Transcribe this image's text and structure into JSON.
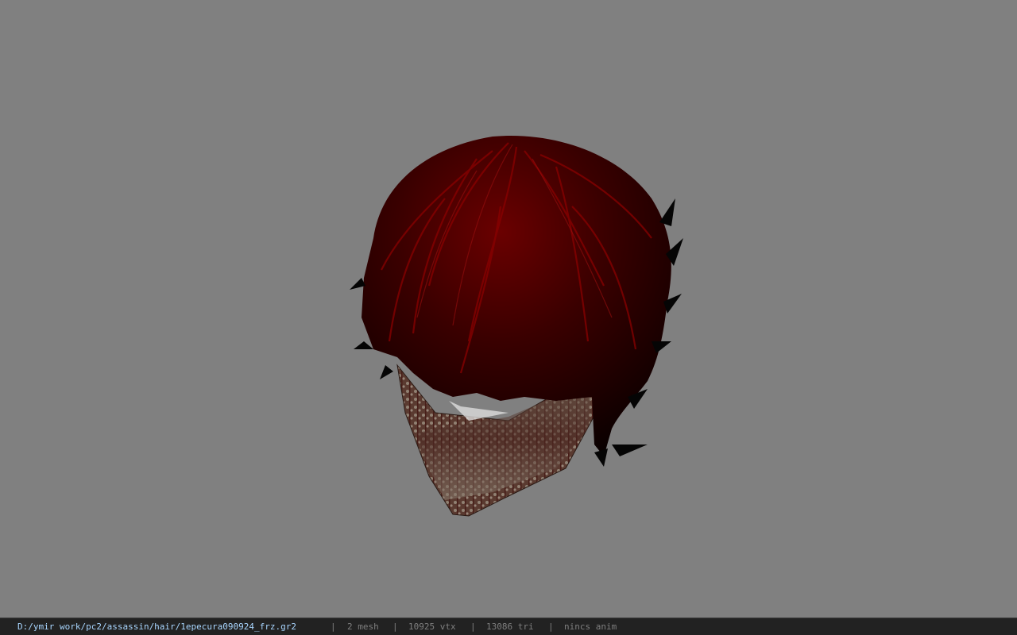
{
  "viewport": {
    "background_color": "#808080",
    "model": {
      "hair_color": "#7a0000",
      "mask_color": "#5a4a3a"
    }
  },
  "status_bar": {
    "file_path": "D:/ymir work/pc2/assassin/hair/1epecura090924_frz.gr2",
    "separator": "|",
    "mesh_count": "2 mesh",
    "vertex_count": "10925 vtx",
    "triangle_count": "13086 tri",
    "anim_status": "nincs anim",
    "path_color": "#a9d6ff",
    "stat_color": "#7f7f7f"
  }
}
